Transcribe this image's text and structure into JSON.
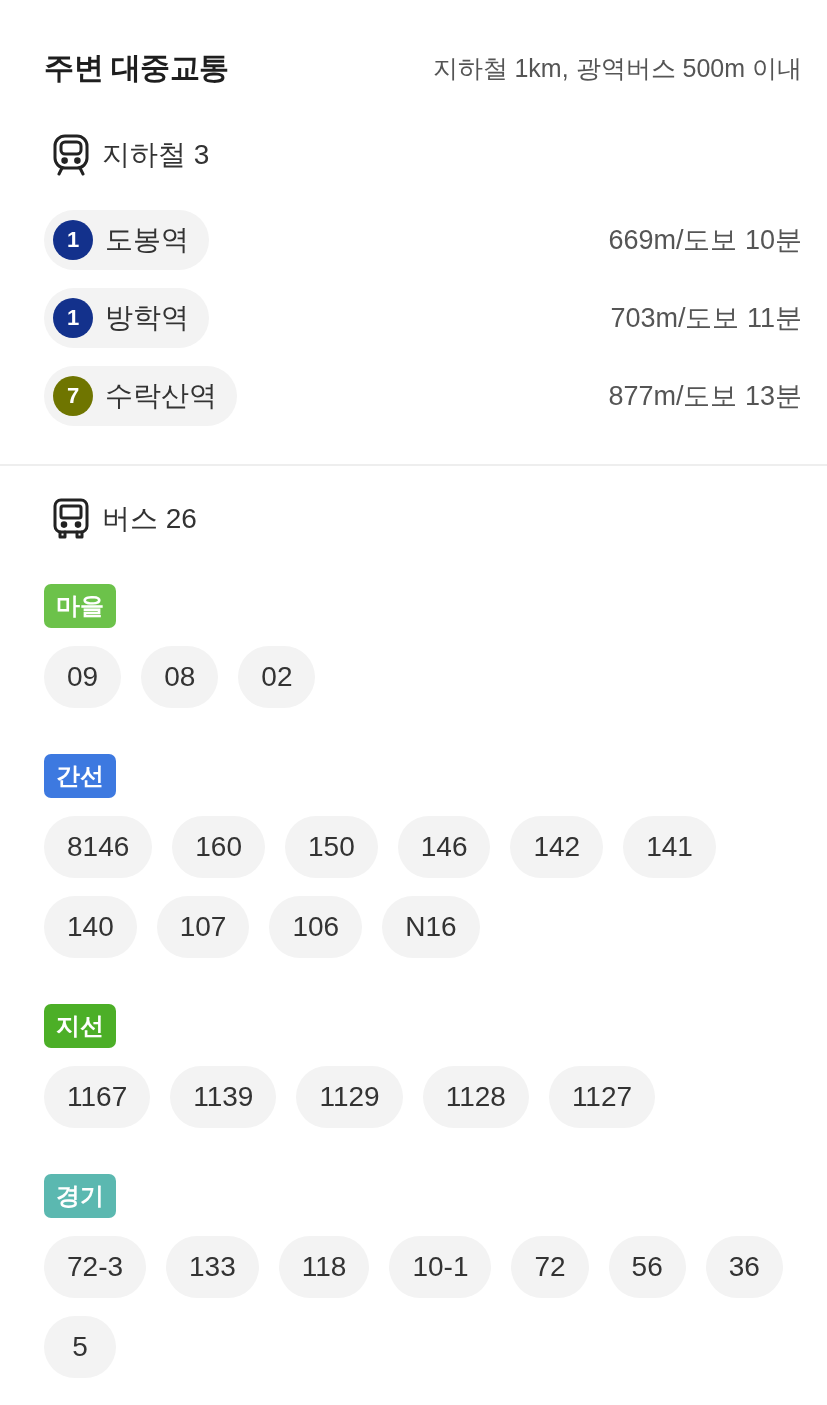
{
  "header": {
    "title": "주변 대중교통",
    "note": "지하철 1km, 광역버스 500m 이내"
  },
  "subway": {
    "label": "지하철 3",
    "stations": [
      {
        "line": "1",
        "color": "#13318c",
        "name": "도봉역",
        "distance": "669m/도보 10분"
      },
      {
        "line": "1",
        "color": "#13318c",
        "name": "방학역",
        "distance": "703m/도보 11분"
      },
      {
        "line": "7",
        "color": "#6f7500",
        "name": "수락산역",
        "distance": "877m/도보 13분"
      }
    ]
  },
  "bus": {
    "label": "버스 26",
    "groups": [
      {
        "category": "마을",
        "color": "#6cc24a",
        "routes": [
          "09",
          "08",
          "02"
        ]
      },
      {
        "category": "간선",
        "color": "#3d79e0",
        "routes": [
          "8146",
          "160",
          "150",
          "146",
          "142",
          "141",
          "140",
          "107",
          "106",
          "N16"
        ]
      },
      {
        "category": "지선",
        "color": "#4caf27",
        "routes": [
          "1167",
          "1139",
          "1129",
          "1128",
          "1127"
        ]
      },
      {
        "category": "경기",
        "color": "#5bb8b0",
        "routes": [
          "72-3",
          "133",
          "118",
          "10-1",
          "72",
          "56",
          "36",
          "5"
        ]
      }
    ]
  }
}
